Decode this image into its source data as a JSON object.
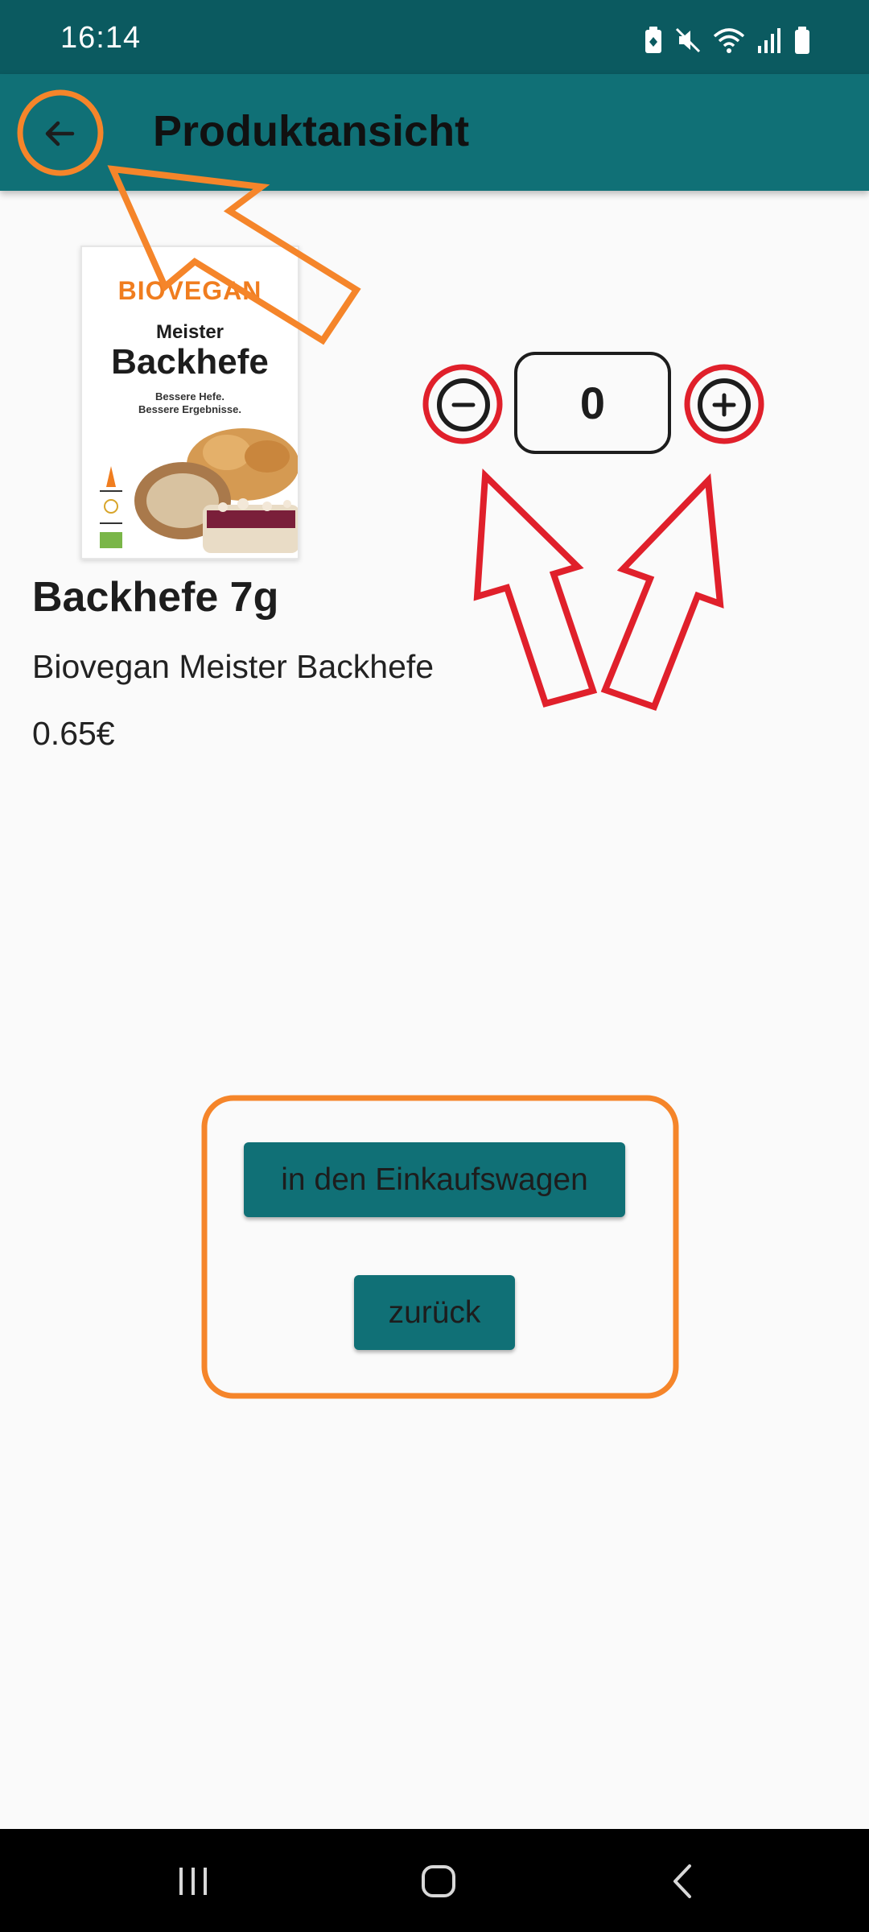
{
  "status_bar": {
    "time": "16:14",
    "icons": [
      "battery-saver-icon",
      "mute-icon",
      "wifi-icon",
      "signal-icon",
      "battery-icon"
    ]
  },
  "app_bar": {
    "title": "Produktansicht",
    "back_icon": "arrow-left-icon"
  },
  "product": {
    "image": {
      "brand": "BIOVEGAN",
      "subtitle": "Meister",
      "title": "Backhefe",
      "tagline_1": "Bessere Hefe.",
      "tagline_2": "Bessere Ergebnisse."
    },
    "name": "Backhefe 7g",
    "description": "Biovegan Meister Backhefe",
    "price": "0.65€"
  },
  "quantity": {
    "value": "0",
    "decrement_icon": "minus-icon",
    "increment_icon": "plus-icon"
  },
  "actions": {
    "add_to_cart_label": "in den Einkaufswagen",
    "back_label": "zurück"
  },
  "nav_bar": {
    "icons": [
      "recents-icon",
      "home-icon",
      "back-icon"
    ]
  },
  "colors": {
    "status_bar": "#0b5a60",
    "app_bar": "#107076",
    "button": "#107076",
    "annotation_orange": "#f5852a",
    "annotation_red": "#e0202b"
  }
}
